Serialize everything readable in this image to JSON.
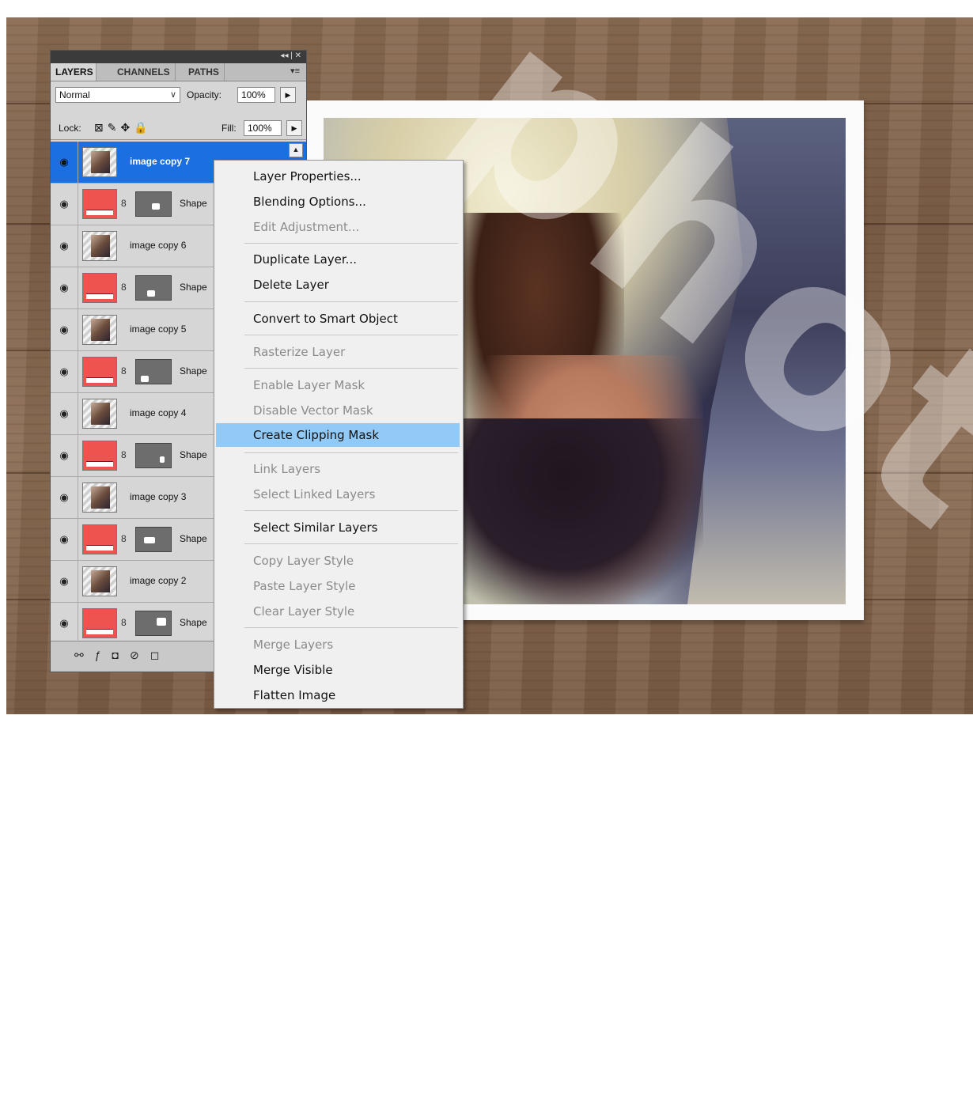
{
  "layers_panel": {
    "tabs": [
      "LAYERS",
      "CHANNELS",
      "PATHS"
    ],
    "blend_mode": "Normal",
    "opacity_label": "Opacity:",
    "opacity_value": "100%",
    "lock_label": "Lock:",
    "fill_label": "Fill:",
    "fill_value": "100%",
    "layers": [
      {
        "name": "image copy 7",
        "type": "image",
        "selected": true
      },
      {
        "name": "Shape",
        "type": "shape"
      },
      {
        "name": "image copy 6",
        "type": "image"
      },
      {
        "name": "Shape",
        "type": "shape"
      },
      {
        "name": "image copy 5",
        "type": "image"
      },
      {
        "name": "Shape",
        "type": "shape"
      },
      {
        "name": "image copy 4",
        "type": "image"
      },
      {
        "name": "Shape",
        "type": "shape"
      },
      {
        "name": "image copy 3",
        "type": "image"
      },
      {
        "name": "Shape",
        "type": "shape"
      },
      {
        "name": "image copy 2",
        "type": "image"
      },
      {
        "name": "Shape",
        "type": "shape"
      },
      {
        "name": "",
        "type": "image"
      }
    ]
  },
  "context_menu": {
    "items": [
      {
        "label": "Layer Properties...",
        "enabled": true
      },
      {
        "label": "Blending Options...",
        "enabled": true
      },
      {
        "label": "Edit Adjustment...",
        "enabled": false
      },
      {
        "label": "Duplicate Layer...",
        "enabled": true
      },
      {
        "label": "Delete Layer",
        "enabled": true
      },
      {
        "label": "Convert to Smart Object",
        "enabled": true
      },
      {
        "label": "Rasterize Layer",
        "enabled": false
      },
      {
        "label": "Enable Layer Mask",
        "enabled": false
      },
      {
        "label": "Disable Vector Mask",
        "enabled": false
      },
      {
        "label": "Create Clipping Mask",
        "enabled": true,
        "highlighted": true
      },
      {
        "label": "Link Layers",
        "enabled": false
      },
      {
        "label": "Select Linked Layers",
        "enabled": false
      },
      {
        "label": "Select Similar Layers",
        "enabled": true
      },
      {
        "label": "Copy Layer Style",
        "enabled": false
      },
      {
        "label": "Paste Layer Style",
        "enabled": false
      },
      {
        "label": "Clear Layer Style",
        "enabled": false
      },
      {
        "label": "Merge Layers",
        "enabled": false
      },
      {
        "label": "Merge Visible",
        "enabled": true
      },
      {
        "label": "Flatten Image",
        "enabled": true
      }
    ]
  },
  "colors": {
    "selection": "#1c6fe0",
    "menu_highlight": "#91c9f7",
    "shape_fill": "#ef5350"
  },
  "watermark": "photoshop"
}
